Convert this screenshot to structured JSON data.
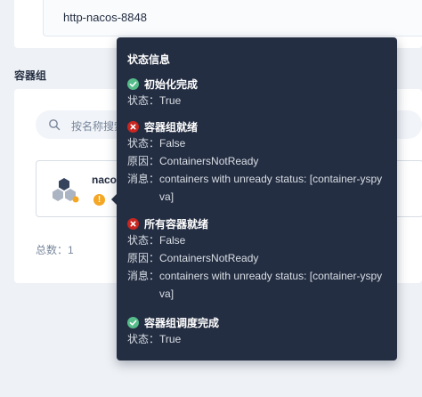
{
  "service": {
    "name": "http-nacos-8848"
  },
  "pod_group": {
    "title": "容器组",
    "search_placeholder": "按名称搜索",
    "pod_name": "nacos",
    "warn_glyph": "!",
    "total_label": "总数：1"
  },
  "tooltip": {
    "title": "状态信息",
    "conditions": [
      {
        "title": "初始化完成",
        "status": "ok",
        "status_label": "状态：",
        "status_value": "True"
      },
      {
        "title": "容器组就绪",
        "status": "error",
        "status_label": "状态：",
        "status_value": "False",
        "reason_label": "原因：",
        "reason_value": "ContainersNotReady",
        "message_label": "消息：",
        "message_value": "containers with unready status: [container-yspyva]"
      },
      {
        "title": "所有容器就绪",
        "status": "error",
        "status_label": "状态：",
        "status_value": "False",
        "reason_label": "原因：",
        "reason_value": "ContainersNotReady",
        "message_label": "消息：",
        "message_value": "containers with unready status: [container-yspyva]"
      },
      {
        "title": "容器组调度完成",
        "status": "ok",
        "status_label": "状态：",
        "status_value": "True"
      }
    ]
  },
  "colors": {
    "ok": "#55bc8a",
    "error": "#ca2621",
    "warning": "#f5a623",
    "tooltip_bg": "#242e42"
  }
}
